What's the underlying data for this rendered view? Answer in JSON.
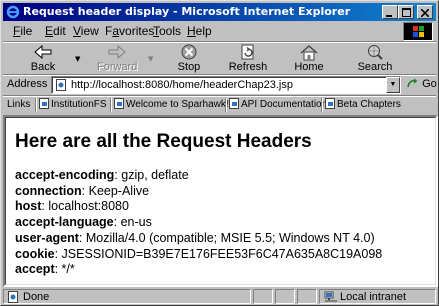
{
  "window": {
    "title": "Request header display - Microsoft Internet Explorer",
    "controls": {
      "minimize": "_",
      "maximize": "□",
      "close": "×"
    }
  },
  "menu": {
    "items": [
      {
        "label": "File",
        "accel": "F",
        "rest": "ile"
      },
      {
        "label": "Edit",
        "accel": "E",
        "rest": "dit"
      },
      {
        "label": "View",
        "accel": "V",
        "rest": "iew"
      },
      {
        "label": "Favorites",
        "accel": "a",
        "pre": "F",
        "rest": "vorites"
      },
      {
        "label": "Tools",
        "accel": "T",
        "rest": "ools"
      },
      {
        "label": "Help",
        "accel": "H",
        "rest": "elp"
      }
    ]
  },
  "toolbar": {
    "back_label": "Back",
    "forward_label": "Forward",
    "stop_label": "Stop",
    "refresh_label": "Refresh",
    "home_label": "Home",
    "search_label": "Search",
    "icons": {
      "back": "back-arrow-icon",
      "forward": "forward-arrow-icon",
      "stop": "stop-icon",
      "refresh": "refresh-icon",
      "home": "home-icon",
      "search": "search-globe-icon"
    }
  },
  "address": {
    "label": "Address",
    "url": "http://localhost:8080/home/headerChap23.jsp",
    "go_label": "Go"
  },
  "links": {
    "label": "Links",
    "items": [
      {
        "label": "InstitutionFS"
      },
      {
        "label": "Welcome to Sparhawk!"
      },
      {
        "label": "API Documentation"
      },
      {
        "label": "Beta Chapters"
      }
    ]
  },
  "content": {
    "heading": "Here are all the Request Headers",
    "headers": [
      {
        "name": "accept-encoding",
        "value": ": gzip, deflate"
      },
      {
        "name": "connection",
        "value": ": Keep-Alive"
      },
      {
        "name": "host",
        "value": ": localhost:8080"
      },
      {
        "name": "accept-language",
        "value": ": en-us"
      },
      {
        "name": "user-agent",
        "value": ": Mozilla/4.0 (compatible; MSIE 5.5; Windows NT 4.0)"
      },
      {
        "name": "cookie",
        "value": ": JSESSIONID=B39E7E176FEE53F6C47A635A8C19A098"
      },
      {
        "name": "accept",
        "value": ": */*"
      }
    ]
  },
  "status": {
    "text": "Done",
    "zone": "Local intranet"
  },
  "colors": {
    "titlebar_start": "#000080",
    "titlebar_end": "#1084d0",
    "chrome": "#c0c0c0"
  }
}
